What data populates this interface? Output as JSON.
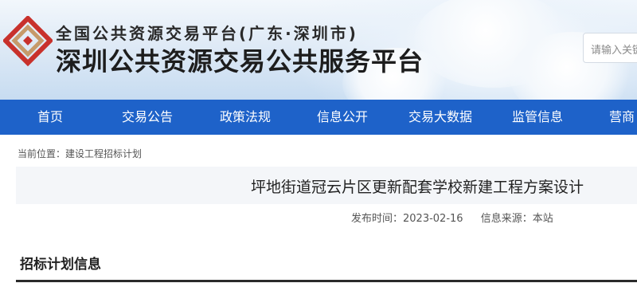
{
  "header": {
    "title_top": "全国公共资源交易平台(广东·深圳市)",
    "title_main": "深圳公共资源交易公共服务平台",
    "logo_icon": "diamond-logo-icon",
    "brand_colors": {
      "logo_red": "#c8312c",
      "logo_tan": "#c69a6a",
      "nav_blue": "#1e62c9"
    }
  },
  "search": {
    "placeholder": "请输入关键"
  },
  "nav": {
    "items": [
      {
        "label": "首页"
      },
      {
        "label": "交易公告"
      },
      {
        "label": "政策法规"
      },
      {
        "label": "信息公开"
      },
      {
        "label": "交易大数据"
      },
      {
        "label": "监管信息"
      },
      {
        "label": "营商"
      }
    ]
  },
  "breadcrumb": {
    "text": "当前位置：建设工程招标计划"
  },
  "article": {
    "title": "坪地街道冠云片区更新配套学校新建工程方案设计",
    "publish_time": "发布时间：2023-02-16",
    "source": "信息来源：本站"
  },
  "section": {
    "heading": "招标计划信息"
  }
}
